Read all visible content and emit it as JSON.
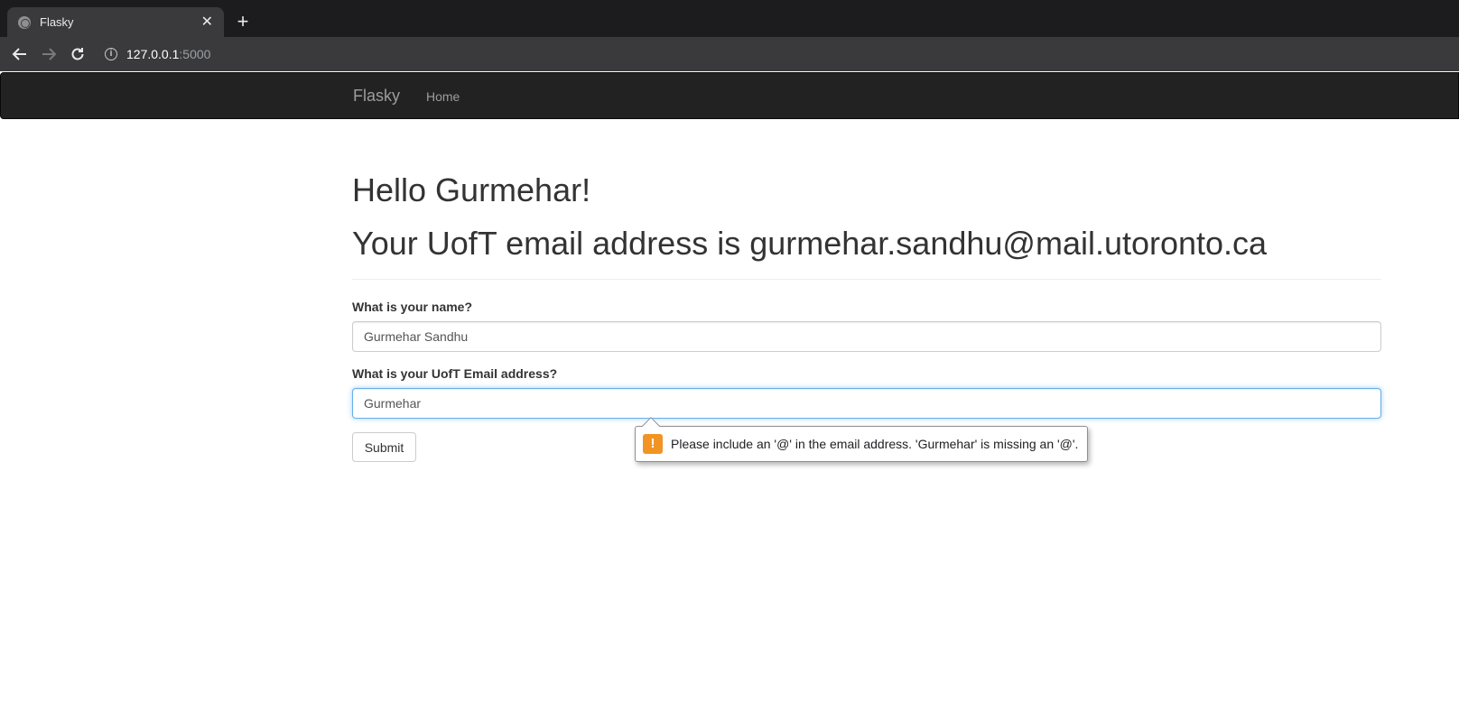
{
  "browser": {
    "tab_title": "Flasky",
    "tab_close_glyph": "✕",
    "new_tab_glyph": "+",
    "url_host": "127.0.0.1",
    "url_port": ":5000",
    "icons": {
      "back": "back-arrow-icon",
      "forward": "forward-arrow-icon",
      "reload": "reload-icon",
      "info": "info-icon"
    }
  },
  "navbar": {
    "brand": "Flasky",
    "links": [
      "Home"
    ]
  },
  "page": {
    "greeting": "Hello Gurmehar!",
    "email_line": "Your UofT email address is gurmehar.sandhu@mail.utoronto.ca"
  },
  "form": {
    "name_label": "What is your name?",
    "name_value": "Gurmehar Sandhu",
    "email_label": "What is your UofT Email address?",
    "email_value": "Gurmehar",
    "submit_label": "Submit"
  },
  "validation": {
    "message": "Please include an '@' in the email address. 'Gurmehar' is missing an '@'.",
    "icon": "warning-icon",
    "icon_color": "#f29423"
  },
  "colors": {
    "navbar_bg": "#222222",
    "focus_border": "#66afe9"
  }
}
